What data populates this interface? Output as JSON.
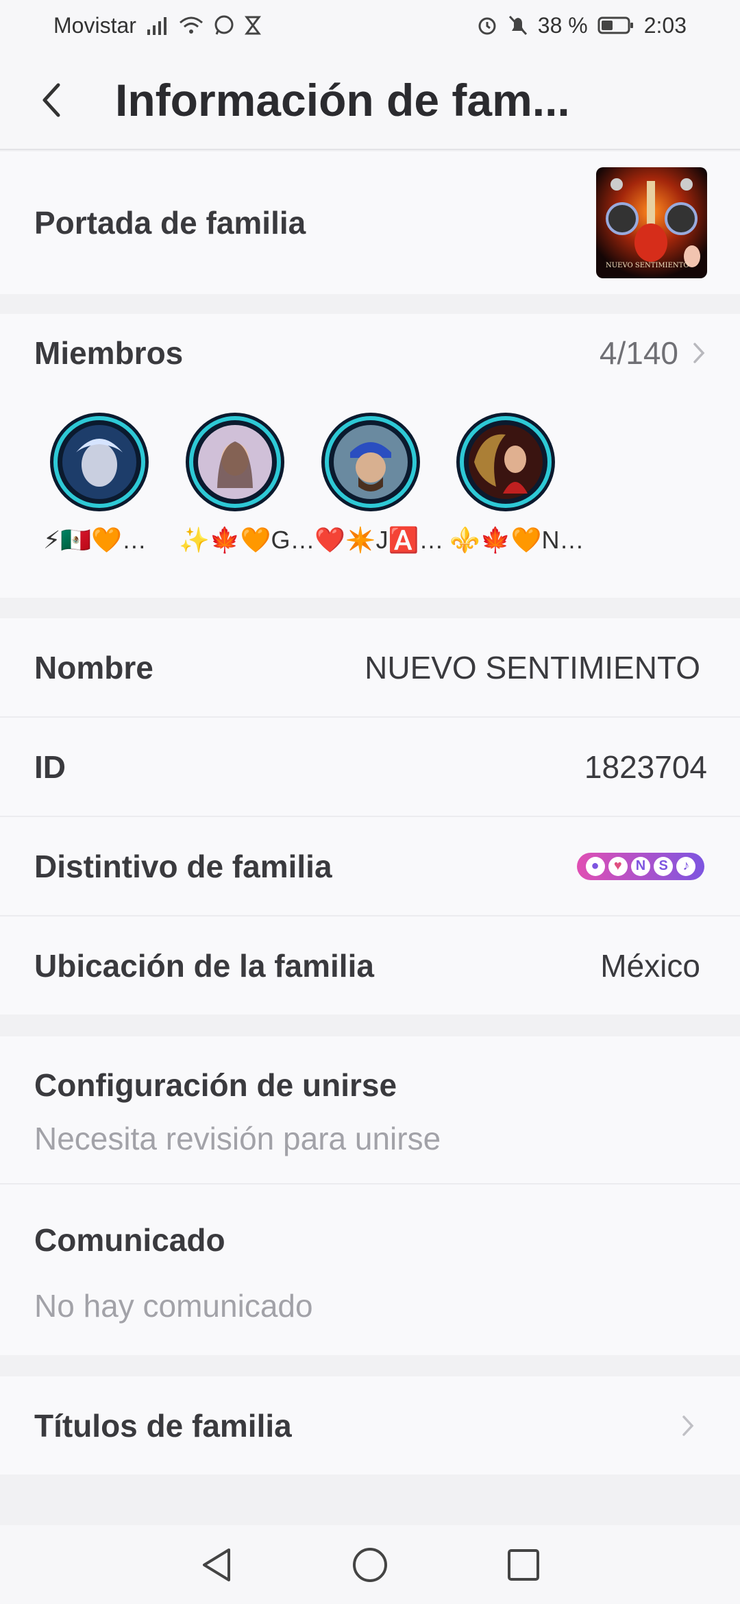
{
  "status_bar": {
    "carrier": "Movistar",
    "battery_percent": "38 %",
    "time": "2:03",
    "icons": [
      "signal-icon",
      "wifi-icon",
      "whatsapp-icon",
      "hourglass-icon",
      "alarm-icon",
      "bell-off-icon",
      "battery-icon"
    ]
  },
  "header": {
    "title": "Información de fam..."
  },
  "cover": {
    "label": "Portada de familia",
    "thumbnail_text": "NUEVO SENTIMIENTO"
  },
  "members": {
    "label": "Miembros",
    "count": "4/140",
    "list": [
      {
        "name": "⚡🇲🇽🧡…"
      },
      {
        "name": "✨🍁🧡G…"
      },
      {
        "name": "❤️✴️J🅰️…"
      },
      {
        "name": "⚜️🍁🧡N…"
      }
    ]
  },
  "info": {
    "name_label": "Nombre",
    "name_value": "NUEVO SENTIMIENTO",
    "id_label": "ID",
    "id_value": "1823704",
    "badge_label": "Distintivo de familia",
    "badge_letters": [
      "N",
      "S"
    ],
    "location_label": "Ubicación de la familia",
    "location_value": "México"
  },
  "join": {
    "label": "Configuración de unirse",
    "value": "Necesita revisión para unirse"
  },
  "announcement": {
    "label": "Comunicado",
    "value": "No hay comunicado"
  },
  "titles": {
    "label": "Títulos de familia"
  },
  "colors": {
    "background": "#f1f1f3",
    "card": "#f9f9fb",
    "text": "#3a3a3e",
    "muted": "#a2a2a8"
  }
}
